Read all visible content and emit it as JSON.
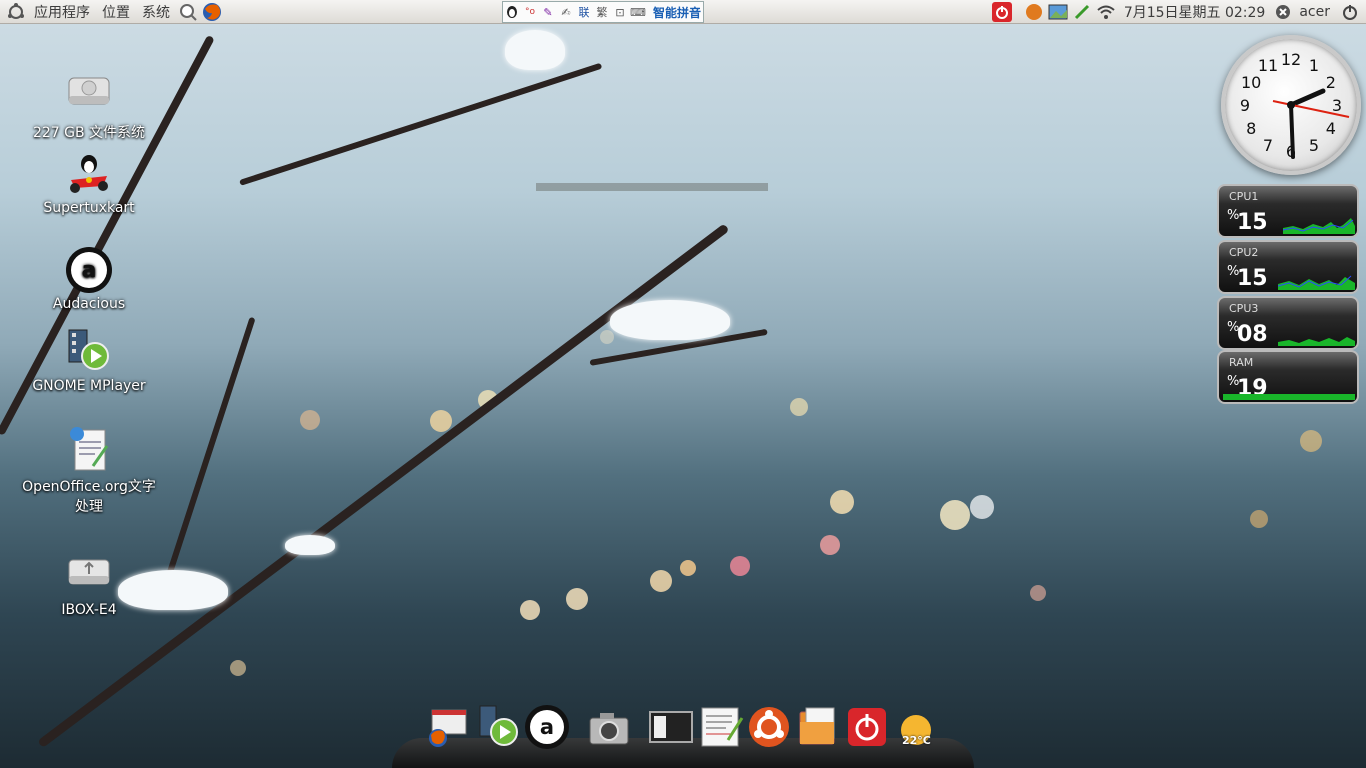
{
  "top_panel": {
    "menus": [
      "应用程序",
      "位置",
      "系统"
    ],
    "launchers": [
      "search-icon",
      "firefox-icon"
    ],
    "ime": {
      "buttons": [
        "tux-icon",
        "symbol-icon",
        "pen-icon",
        "handwrite-icon",
        "联",
        "繁",
        "lock-icon",
        "keyboard-icon"
      ],
      "label": "智能拼音"
    },
    "tray": {
      "icons": [
        "power-icon",
        "weather-icon",
        "photo-icon",
        "pencil-icon",
        "wifi-icon"
      ],
      "clock": "7月15日星期五 02:29",
      "user": "acer"
    }
  },
  "desktop": {
    "icons": [
      {
        "label": "227 GB 文件系统",
        "icon": "harddisk-icon"
      },
      {
        "label": "Supertuxkart",
        "icon": "supertuxkart-icon"
      },
      {
        "label": "Audacious",
        "icon": "audacious-icon"
      },
      {
        "label": "GNOME MPlayer",
        "icon": "mplayer-icon"
      },
      {
        "label": "OpenOffice.org文字处理",
        "icon": "writer-icon"
      },
      {
        "label": "IBOX-E4",
        "icon": "usb-drive-icon"
      }
    ]
  },
  "widgets": {
    "clock_numbers": [
      "12",
      "1",
      "2",
      "3",
      "4",
      "5",
      "6",
      "7",
      "8",
      "9",
      "10",
      "11"
    ],
    "meters": [
      {
        "label": "CPU1",
        "unit": "%",
        "value": "15",
        "level": 0.15
      },
      {
        "label": "CPU2",
        "unit": "%",
        "value": "15",
        "level": 0.15
      },
      {
        "label": "CPU3",
        "unit": "%",
        "value": "08",
        "level": 0.08
      },
      {
        "label": "RAM",
        "unit": "%",
        "value": "19",
        "level": 0.19
      }
    ]
  },
  "dock": {
    "items": [
      "firefox-window-icon",
      "mplayer-icon",
      "audacious-icon",
      "camera-icon",
      "window-switcher-icon",
      "text-editor-icon",
      "ubuntu-icon",
      "files-icon",
      "power-icon",
      "weather-icon"
    ],
    "weather_temp": "22°C"
  },
  "colors": {
    "panel_bg": "#e4e1dc",
    "accent_red": "#d9262b",
    "meter_graph": "#19b62a"
  }
}
